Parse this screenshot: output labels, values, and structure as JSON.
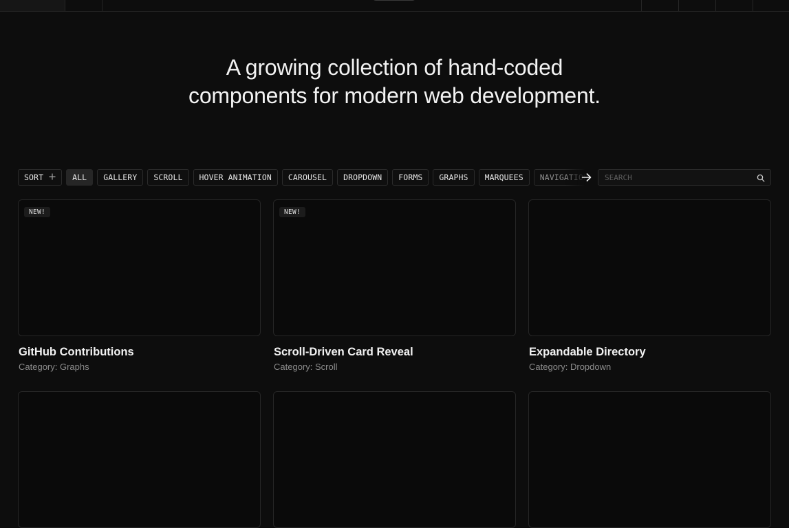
{
  "hero": {
    "line1": "A growing collection of hand-coded",
    "line2": "components for modern web development."
  },
  "filters": {
    "sort_label": "SORT",
    "sort_icon": "plus-icon",
    "items": [
      {
        "label": "ALL",
        "active": true
      },
      {
        "label": "GALLERY",
        "active": false
      },
      {
        "label": "SCROLL",
        "active": false
      },
      {
        "label": "HOVER ANIMATION",
        "active": false
      },
      {
        "label": "CAROUSEL",
        "active": false
      },
      {
        "label": "DROPDOWN",
        "active": false
      },
      {
        "label": "FORMS",
        "active": false
      },
      {
        "label": "GRAPHS",
        "active": false
      },
      {
        "label": "MARQUEES",
        "active": false
      },
      {
        "label": "NAVIGATION",
        "active": false
      }
    ],
    "scroll_icon": "arrow-right-icon"
  },
  "search": {
    "placeholder": "SEARCH",
    "value": "",
    "icon": "search-icon"
  },
  "cards": [
    {
      "title": "GitHub Contributions",
      "category": "Category: Graphs",
      "badge": "NEW!"
    },
    {
      "title": "Scroll-Driven Card Reveal",
      "category": "Category: Scroll",
      "badge": "NEW!"
    },
    {
      "title": "Expandable Directory",
      "category": "Category: Dropdown",
      "badge": ""
    }
  ],
  "colors": {
    "background": "#0d0d0d",
    "border": "#262626",
    "active_chip": "#262626",
    "text": "#f2f2f2",
    "muted": "#8c8c8c"
  }
}
